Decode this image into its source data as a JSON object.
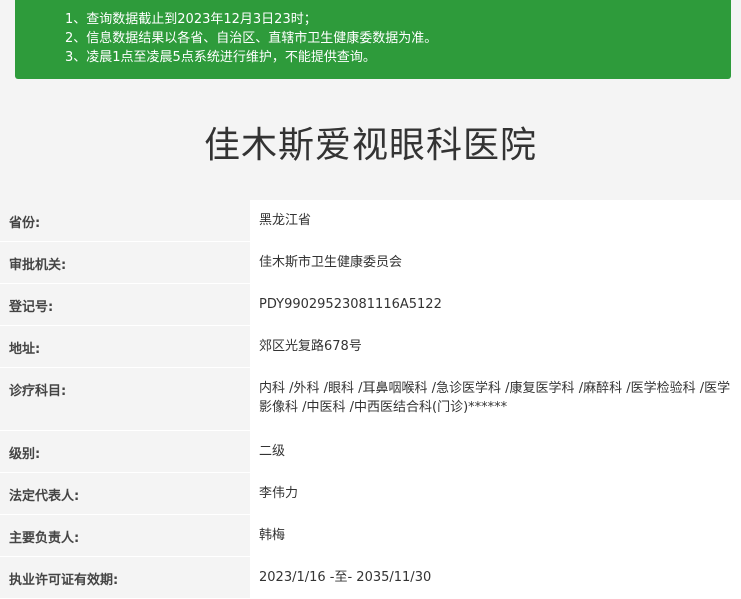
{
  "notice": {
    "lines": [
      "1、查询数据截止到2023年12月3日23时；",
      "2、信息数据结果以各省、自治区、直辖市卫生健康委数据为准。",
      "3、凌晨1点至凌晨5点系统进行维护，不能提供查询。"
    ]
  },
  "hospital": {
    "name": "佳木斯爱视眼科医院"
  },
  "info": {
    "rows": [
      {
        "label": "省份:",
        "value": "黑龙江省"
      },
      {
        "label": "审批机关:",
        "value": "佳木斯市卫生健康委员会"
      },
      {
        "label": "登记号:",
        "value": "PDY99029523081116A5122"
      },
      {
        "label": "地址:",
        "value": "郊区光复路678号"
      },
      {
        "label": "诊疗科目:",
        "value": "内科 /外科 /眼科 /耳鼻咽喉科 /急诊医学科 /康复医学科 /麻醉科 /医学检验科 /医学影像科 /中医科 /中西医结合科(门诊)******"
      },
      {
        "label": "级别:",
        "value": "二级"
      },
      {
        "label": "法定代表人:",
        "value": "李伟力"
      },
      {
        "label": "主要负责人:",
        "value": "韩梅"
      },
      {
        "label": "执业许可证有效期:",
        "value": "2023/1/16 -至- 2035/11/30"
      }
    ]
  },
  "colors": {
    "notice_bg": "#2e9b3b",
    "page_bg": "#f4f4f4",
    "value_bg": "#ffffff"
  }
}
